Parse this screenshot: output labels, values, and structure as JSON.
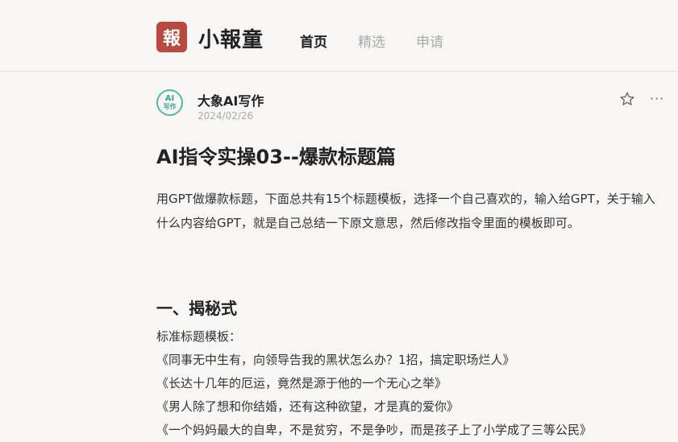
{
  "header": {
    "logo_char": "報",
    "site_name": "小報童",
    "nav": [
      {
        "label": "首页",
        "active": true
      },
      {
        "label": "精选",
        "active": false
      },
      {
        "label": "申请",
        "active": false
      }
    ]
  },
  "author": {
    "avatar_line1": "AI",
    "avatar_line2": "写作",
    "name": "大象AI写作",
    "date": "2024/02/26"
  },
  "icons": {
    "star": "star-icon",
    "more": "more-icon"
  },
  "article": {
    "title": "AI指令实操03--爆款标题篇",
    "intro": "用GPT做爆款标题，下面总共有15个标题模板，选择一个自己喜欢的，输入给GPT，关于输入什么内容给GPT，就是自己总结一下原文意思，然后修改指令里面的模板即可。",
    "section1": {
      "heading": "一、揭秘式",
      "lines": [
        "标准标题模板：",
        "《同事无中生有，向领导告我的黑状怎么办？1招，搞定职场烂人》",
        "《长达十几年的厄运，竟然是源于他的一个无心之举》",
        "《男人除了想和你结婚，还有这种欲望，才是真的爱你》",
        "《一个妈妈最大的自卑，不是贫穷，不是争吵，而是孩子上了小学成了三等公民》"
      ]
    }
  },
  "colors": {
    "brand": "#b94a3f",
    "avatar": "#4fb9a3",
    "background": "#f7f6f4"
  }
}
